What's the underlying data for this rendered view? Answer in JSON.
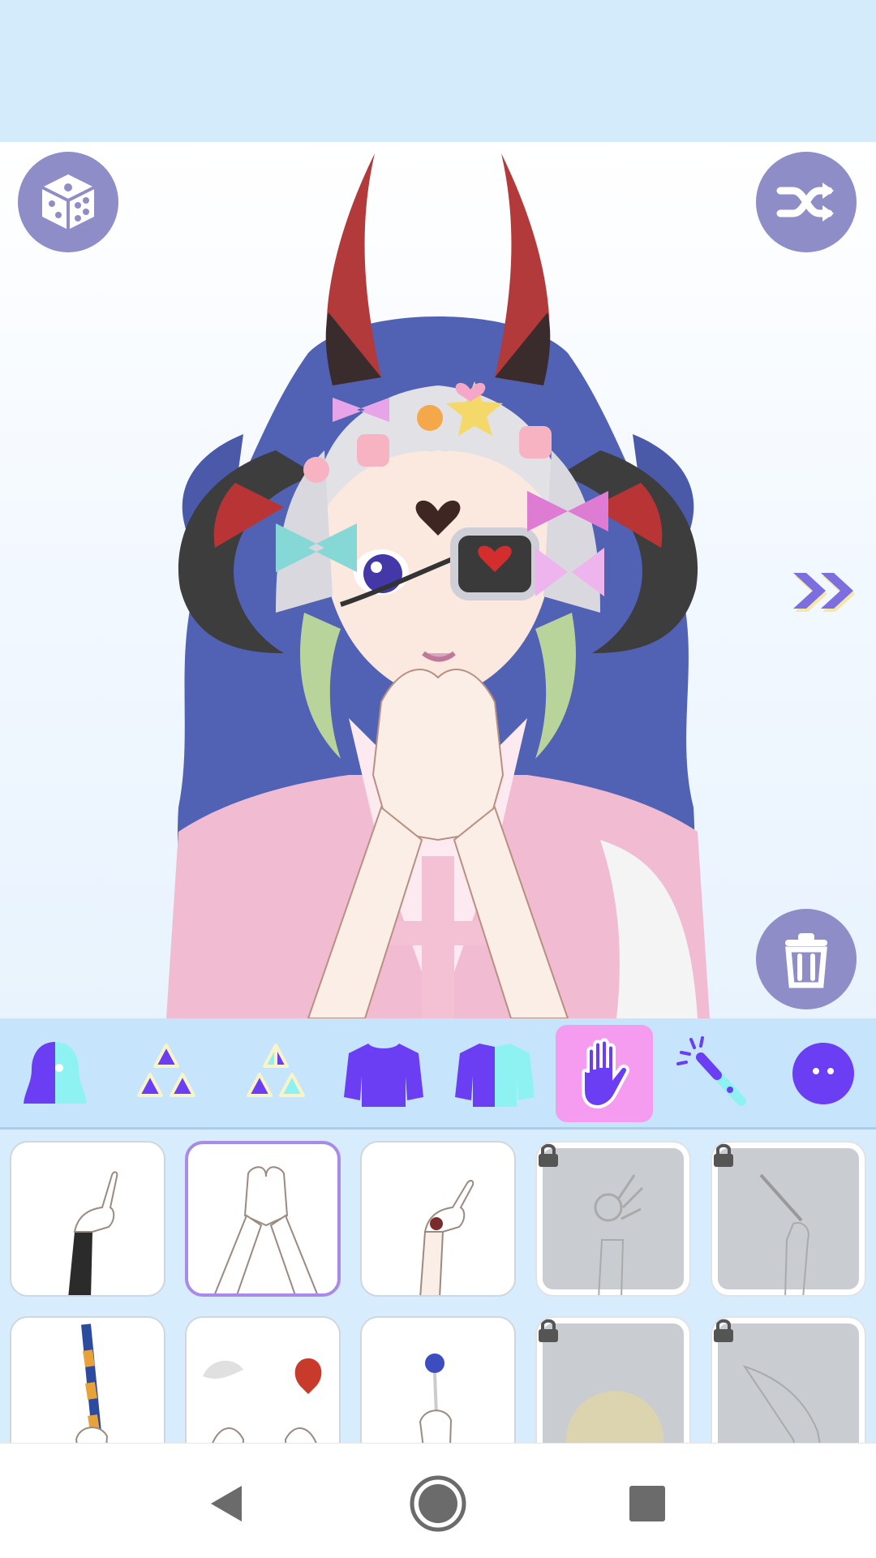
{
  "toolbar": {
    "randomize_icon": "dice-icon",
    "shuffle_icon": "shuffle-icon",
    "next_icon": "double-chevron-right-icon",
    "delete_icon": "trash-icon"
  },
  "categories": [
    {
      "id": "face",
      "icon": "face-shape-icon",
      "active": false
    },
    {
      "id": "pattern-1",
      "icon": "triangles-icon",
      "active": false
    },
    {
      "id": "pattern-2",
      "icon": "triangles-split-icon",
      "active": false
    },
    {
      "id": "top",
      "icon": "shirt-icon",
      "active": false
    },
    {
      "id": "top-2",
      "icon": "shirt-split-icon",
      "active": false
    },
    {
      "id": "hands",
      "icon": "hand-icon",
      "active": true
    },
    {
      "id": "wand",
      "icon": "magic-wand-icon",
      "active": false
    },
    {
      "id": "accessory",
      "icon": "circle-face-icon",
      "active": false
    }
  ],
  "items": [
    {
      "name": "pointing-hand-black-sleeve",
      "selected": false,
      "locked": false
    },
    {
      "name": "clasped-hands",
      "selected": true,
      "locked": false
    },
    {
      "name": "pointing-hand-rose-tattoo",
      "selected": false,
      "locked": false
    },
    {
      "name": "ok-sign-hand",
      "selected": false,
      "locked": true
    },
    {
      "name": "hand-with-syringe",
      "selected": false,
      "locked": true
    },
    {
      "name": "hand-with-staff",
      "selected": false,
      "locked": false
    },
    {
      "name": "hands-feather-heart",
      "selected": false,
      "locked": false
    },
    {
      "name": "hand-with-lollipop",
      "selected": false,
      "locked": false
    },
    {
      "name": "glowing-hands",
      "selected": false,
      "locked": true
    },
    {
      "name": "reaching-hand",
      "selected": false,
      "locked": true
    }
  ],
  "nav": {
    "back_icon": "back-triangle-icon",
    "home_icon": "home-circle-icon",
    "recents_icon": "recents-square-icon"
  },
  "colors": {
    "accent": "#8f8dc8",
    "category_active": "#f59cf0",
    "icon_purple": "#6842f2",
    "banner": "#d4ebfb"
  }
}
